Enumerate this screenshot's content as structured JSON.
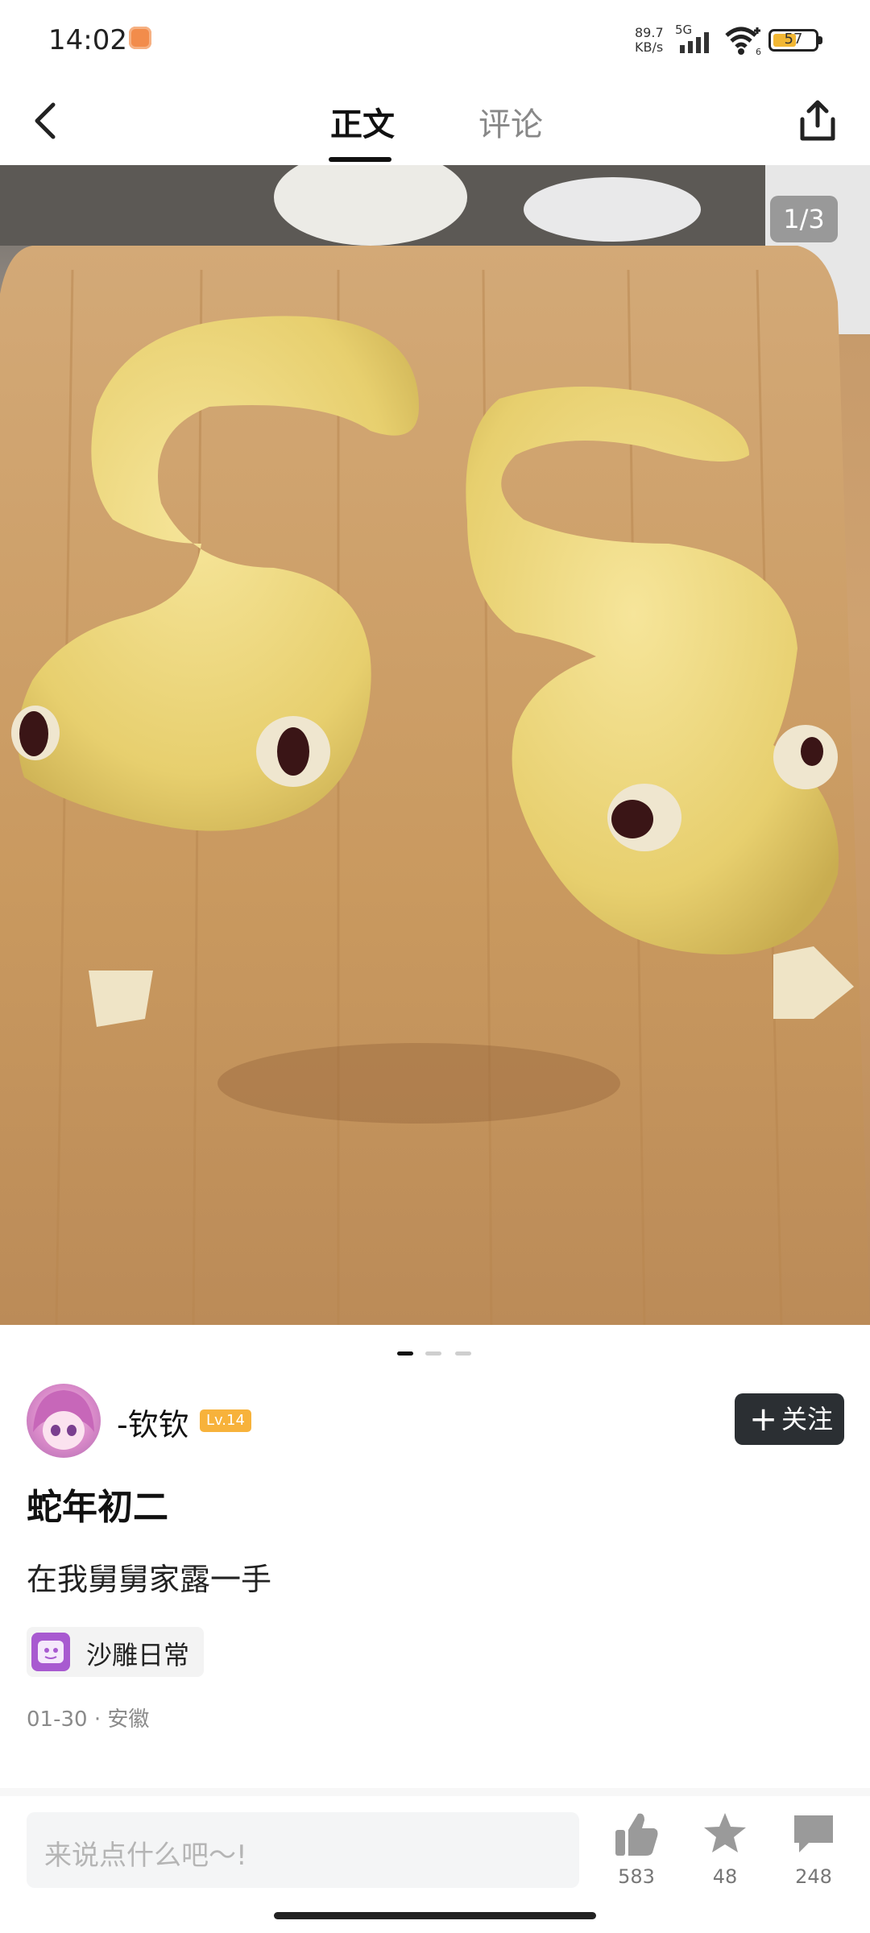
{
  "status_bar": {
    "time": "14:02",
    "network_speed": "89.7",
    "network_unit": "KB/s",
    "network_type": "5G",
    "wifi_sub": "6",
    "battery": "57",
    "battery_level": 0.57
  },
  "header": {
    "tabs": [
      {
        "label": "正文",
        "active": true
      },
      {
        "label": "评论",
        "active": false
      }
    ]
  },
  "photo": {
    "counter": "1/3",
    "page_index": 1,
    "page_count": 3
  },
  "author": {
    "name": "-钦钦",
    "level": "Lv.14",
    "follow_label": "关注"
  },
  "post": {
    "title": "蛇年初二",
    "text": "在我舅舅家露一手",
    "topic": "沙雕日常",
    "meta": "01-30 · 安徽"
  },
  "bottom_bar": {
    "input_placeholder": "来说点什么吧～!",
    "likes": "583",
    "favorites": "48",
    "comments": "248"
  },
  "colors": {
    "accent_dark": "#2b2f33",
    "level_badge": "#f7b23b",
    "icon_gray": "#9a9a9a"
  },
  "icons": [
    "back-icon",
    "share-icon",
    "like-icon",
    "star-icon",
    "comment-icon",
    "signal-icon",
    "wifi-icon",
    "battery-icon"
  ]
}
